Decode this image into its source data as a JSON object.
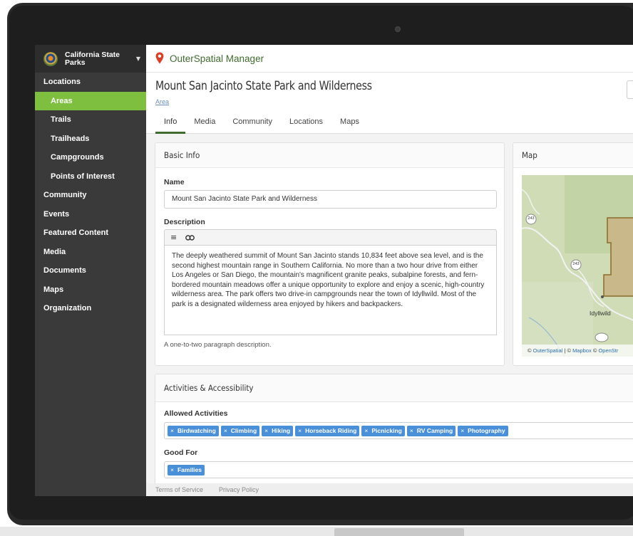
{
  "app": {
    "title": "OuterSpatial Manager"
  },
  "org": {
    "name": "California State Parks"
  },
  "sidebar": {
    "items": [
      {
        "label": "Locations",
        "level": 0
      },
      {
        "label": "Areas",
        "level": 1,
        "active": true
      },
      {
        "label": "Trails",
        "level": 1
      },
      {
        "label": "Trailheads",
        "level": 1
      },
      {
        "label": "Campgrounds",
        "level": 1
      },
      {
        "label": "Points of Interest",
        "level": 1
      },
      {
        "label": "Community",
        "level": 0
      },
      {
        "label": "Events",
        "level": 0
      },
      {
        "label": "Featured Content",
        "level": 0
      },
      {
        "label": "Media",
        "level": 0
      },
      {
        "label": "Documents",
        "level": 0
      },
      {
        "label": "Maps",
        "level": 0
      },
      {
        "label": "Organization",
        "level": 0
      }
    ]
  },
  "page": {
    "title": "Mount San Jacinto State Park and Wilderness",
    "type_link": "Area",
    "tabs": [
      "Info",
      "Media",
      "Community",
      "Locations",
      "Maps"
    ],
    "active_tab": "Info"
  },
  "basic_info": {
    "heading": "Basic Info",
    "name_label": "Name",
    "name_value": "Mount San Jacinto State Park and Wilderness",
    "description_label": "Description",
    "description_value": "The deeply weathered summit of Mount San Jacinto stands 10,834 feet above sea level, and is the second highest mountain range in Southern California. No more than a two hour drive from either Los Angeles or San Diego, the mountain's magnificent granite peaks, subalpine forests, and fern-bordered mountain meadows offer a unique opportunity to explore and enjoy a scenic, high-country wilderness area. The park offers two drive-in campgrounds near the town of Idyllwild. Most of the park is a designated wilderness area enjoyed by hikers and backpackers.",
    "description_help": "A one-to-two paragraph description.",
    "toolbar_icons": [
      "list-icon",
      "link-icon"
    ]
  },
  "map": {
    "heading": "Map",
    "town_label": "Idyllwild",
    "route_labels": [
      "243",
      "243"
    ],
    "credit_parts": [
      "© ",
      "OuterSpatial",
      " | © ",
      "Mapbox",
      " © ",
      "OpenStr"
    ]
  },
  "activities": {
    "heading": "Activities & Accessibility",
    "allowed_label": "Allowed Activities",
    "allowed": [
      "Birdwatching",
      "Climbing",
      "Hiking",
      "Horseback Riding",
      "Picnicking",
      "RV Camping",
      "Photography"
    ],
    "good_for_label": "Good For",
    "good_for": [
      "Families"
    ],
    "tag_remove_glyph": "×"
  },
  "footer": {
    "links": [
      "Terms of Service",
      "Privacy Policy"
    ]
  },
  "colors": {
    "accent_green": "#7fbf3f",
    "brand_green": "#3f6b2e",
    "tag_blue": "#4a90d9",
    "sidebar_bg": "#3a3a3a",
    "pin_red": "#d9402a"
  }
}
